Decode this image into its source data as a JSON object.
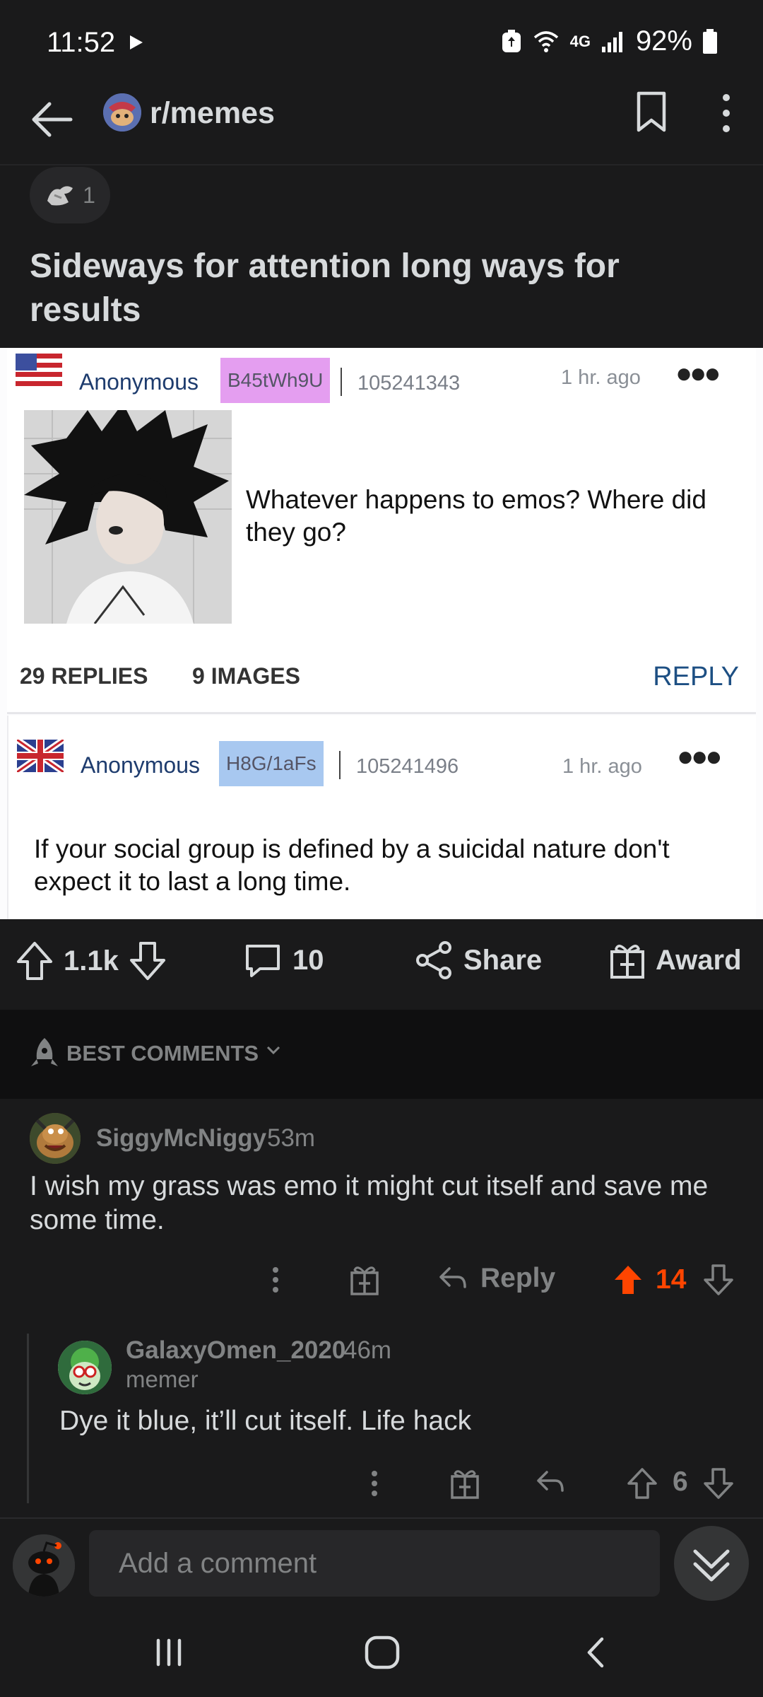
{
  "status_bar": {
    "time": "11:52",
    "network": "4G",
    "battery": "92%"
  },
  "header": {
    "subreddit": "r/memes"
  },
  "post": {
    "award_count": "1",
    "title": "Sideways for attention long ways for results",
    "image": {
      "op": {
        "name": "Anonymous",
        "poster_id": "B45tWh9U",
        "poster_id_color": "#e49ef0",
        "post_number": "105241343",
        "time": "1 hr. ago",
        "text": "Whatever happens to emos? Where did they go?",
        "replies": "29 REPLIES",
        "images": "9 IMAGES",
        "reply_label": "REPLY"
      },
      "reply": {
        "name": "Anonymous",
        "poster_id": "H8G/1aFs",
        "poster_id_color": "#a8c8f0",
        "post_number": "105241496",
        "time": "1 hr. ago",
        "text": "If your social group is defined by a suicidal nature don't expect it to last a long time."
      }
    },
    "actions": {
      "score": "1.1k",
      "comments": "10",
      "share": "Share",
      "award": "Award"
    }
  },
  "comments_sort": {
    "label": "BEST COMMENTS"
  },
  "comments": [
    {
      "user": "SiggyMcNiggy",
      "age": "53m",
      "body": "I wish my grass was emo it might cut itself and save me some time.",
      "reply_label": "Reply",
      "score": "14",
      "upvoted": true
    },
    {
      "user": "GalaxyOmen_2020",
      "age": "46m",
      "flair": "memer",
      "body": "Dye it blue, it’ll cut itself. Life hack",
      "score": "6",
      "upvoted": false
    }
  ],
  "comment_input": {
    "placeholder": "Add a comment"
  },
  "colors": {
    "background": "#1a1a1b",
    "upvote_active": "#ff4500",
    "muted_text": "#818384"
  }
}
